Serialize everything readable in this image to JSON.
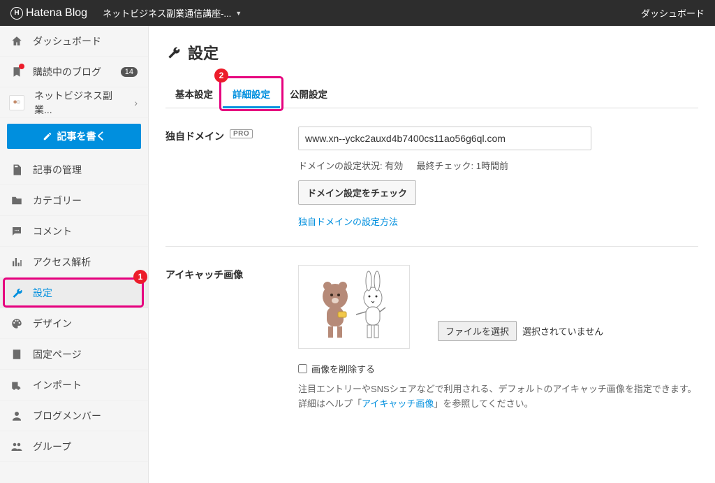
{
  "header": {
    "logo_text": "Hatena Blog",
    "blog_selector": "ネットビジネス副業通信講座-...",
    "dashboard_link": "ダッシュボード"
  },
  "sidebar": {
    "dashboard": "ダッシュボード",
    "subscriptions": "購読中のブログ",
    "subscriptions_count": "14",
    "current_blog": "ネットビジネス副業...",
    "write_post": "記事を書く",
    "manage_posts": "記事の管理",
    "categories": "カテゴリー",
    "comments": "コメント",
    "analytics": "アクセス解析",
    "settings": "設定",
    "design": "デザイン",
    "fixed_pages": "固定ページ",
    "import": "インポート",
    "members": "ブログメンバー",
    "groups": "グループ"
  },
  "annotations": {
    "one": "1",
    "two": "2"
  },
  "page": {
    "title": "設定",
    "tabs": {
      "basic": "基本設定",
      "advanced": "詳細設定",
      "publish": "公開設定"
    }
  },
  "domain": {
    "label": "独自ドメイン",
    "pro": "PRO",
    "value": "www.xn--yckc2auxd4b7400cs11ao56g6ql.com",
    "status_label": "ドメインの設定状況: 有効",
    "last_check": "最終チェック: 1時間前",
    "check_btn": "ドメイン設定をチェック",
    "help_link": "独自ドメインの設定方法"
  },
  "eyecatch": {
    "label": "アイキャッチ画像",
    "file_btn": "ファイルを選択",
    "file_status": "選択されていません",
    "delete": "画像を削除する",
    "note1": "注目エントリーやSNSシェアなどで利用される、デフォルトのアイキャッチ画像を指定できます。",
    "note2a": "詳細はヘルプ「",
    "note2link": "アイキャッチ画像",
    "note2b": "」を参照してください。"
  }
}
